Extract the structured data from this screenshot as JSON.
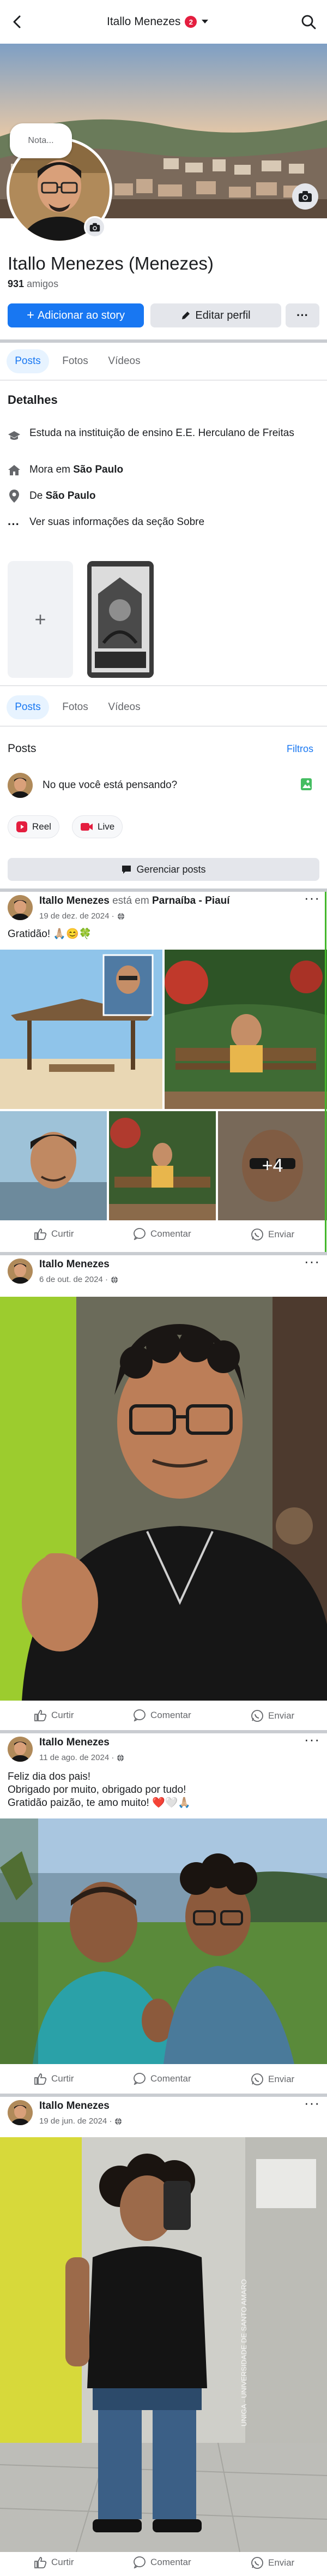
{
  "header": {
    "title": "Itallo Menezes",
    "notif_count": "2"
  },
  "profile": {
    "note_placeholder": "Nota...",
    "name": "Itallo Menezes (Menezes)",
    "friends_count": "931",
    "friends_label": "amigos",
    "add_story": "Adicionar ao story",
    "edit_profile": "Editar perfil",
    "more": "···"
  },
  "tabs": [
    "Posts",
    "Fotos",
    "Vídeos"
  ],
  "details": {
    "title": "Detalhes",
    "study": "Estuda na instituição de ensino E.E. Herculano de Freitas",
    "lives_prefix": "Mora em",
    "lives_city": "São Paulo",
    "from_prefix": "De",
    "from_city": "São Paulo",
    "about": "Ver suas informações da seção Sobre"
  },
  "composer": {
    "title": "Posts",
    "filters": "Filtros",
    "placeholder": "No que você está pensando?",
    "reel": "Reel",
    "live": "Live",
    "manage": "Gerenciar posts"
  },
  "actions": {
    "like": "Curtir",
    "comment": "Comentar",
    "send": "Enviar"
  },
  "posts": [
    {
      "author": "Itallo Menezes",
      "at": "está em",
      "place": "Parnaíba - Piauí",
      "date": "19 de dez. de 2024 ·",
      "text": "Gratidão! 🙏🏼😊🍀",
      "more_photos": "+4"
    },
    {
      "author": "Itallo Menezes",
      "date": "6 de out. de 2024 ·"
    },
    {
      "author": "Itallo Menezes",
      "date": "11 de ago. de 2024 ·",
      "text_lines": [
        "Feliz dia dos pais!",
        "Obrigado por muito, obrigado por tudo!",
        "Gratidão paizão, te amo muito! ❤️🤍🙏🏼"
      ]
    },
    {
      "author": "Itallo Menezes",
      "date": "19 de jun. de 2024 ·",
      "watermark": "UNIGA · UNIVERSIDADE DE SANTO AMARO"
    }
  ],
  "colors": {
    "accent": "#1877f2",
    "tab_active_bg": "#e7f3ff",
    "secondary_btn": "#e4e6eb",
    "green_line": "#42b72a",
    "badge": "#e41e3f"
  }
}
